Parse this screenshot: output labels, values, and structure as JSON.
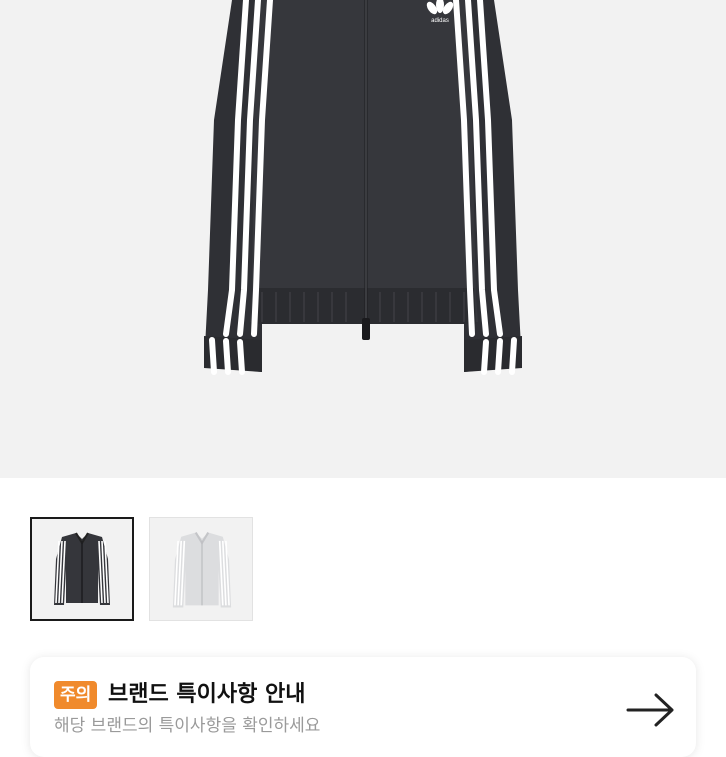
{
  "product": {
    "main_image": {
      "description_icon": "black-track-jacket-three-stripes-image",
      "logo_text": "adidas"
    },
    "thumbnails": [
      {
        "color_name": "black",
        "selected": true,
        "icon": "black-jacket-thumbnail"
      },
      {
        "color_name": "light-grey",
        "selected": false,
        "icon": "grey-jacket-thumbnail"
      }
    ]
  },
  "notice": {
    "badge": "주의",
    "title": "브랜드 특이사항 안내",
    "subtitle": "해당 브랜드의 특이사항을 확인하세요",
    "arrow_icon": "arrow-right-icon",
    "badge_color": "#f08a2c"
  }
}
